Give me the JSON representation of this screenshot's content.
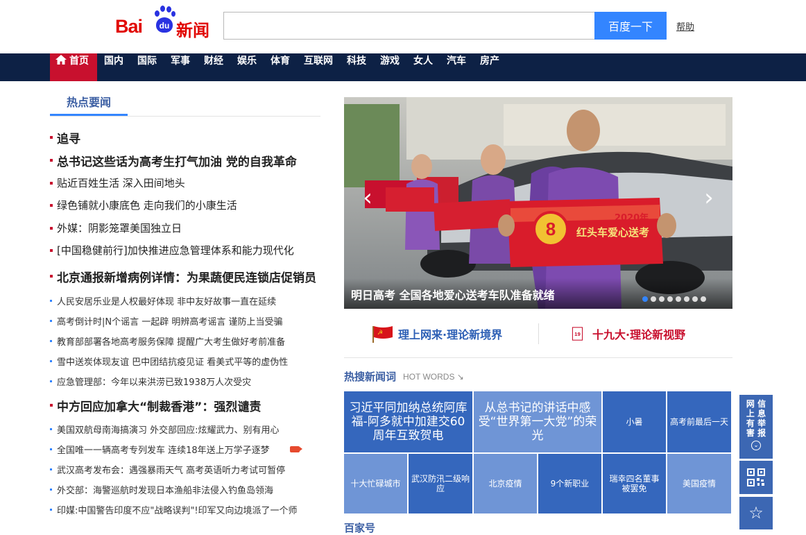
{
  "header": {
    "logo_bai": "Bai",
    "logo_du": "du",
    "logo_news": "新闻",
    "search_placeholder": "",
    "search_button": "百度一下",
    "help": "帮助"
  },
  "nav": {
    "items": [
      "首页",
      "国内",
      "国际",
      "军事",
      "财经",
      "娱乐",
      "体育",
      "互联网",
      "科技",
      "游戏",
      "女人",
      "汽车",
      "房产"
    ]
  },
  "section": {
    "title": "热点要闻"
  },
  "news": [
    {
      "text": "追寻",
      "level": 1
    },
    {
      "text": "总书记这些话为高考生打气加油 党的自我革命",
      "level": 1
    },
    {
      "text": "贴近百姓生活 深入田间地头",
      "level": 2
    },
    {
      "text": "绿色铺就小康底色 走向我们的小康生活",
      "level": 2
    },
    {
      "text": "外媒：阴影笼罩美国独立日",
      "level": 2
    },
    {
      "text": "[中国稳健前行]加快推进应急管理体系和能力现代化",
      "level": 2
    },
    {
      "text": "北京通报新增病例详情：为果蔬便民连锁店促销员",
      "level": 1
    },
    {
      "text": "人民安居乐业是人权最好体现 非中友好故事一直在延续",
      "level": 3
    },
    {
      "text": "高考倒计时|N个谣言 一起辟 明辨高考谣言 谨防上当受骗",
      "level": 3
    },
    {
      "text": "教育部部署各地高考服务保障 提醒广大考生做好考前准备",
      "level": 3
    },
    {
      "text": "雪中送炭体现友谊 巴中团结抗疫见证 看美式平等的虚伪性",
      "level": 3
    },
    {
      "text": "应急管理部：今年以来洪涝已致1938万人次受灾",
      "level": 3
    },
    {
      "text": "中方回应加拿大“制裁香港”：强烈谴责",
      "level": 1
    },
    {
      "text": "美国双航母南海搞演习 外交部回应:炫耀武力、别有用心",
      "level": 3
    },
    {
      "text": "全国唯一一辆高考专列发车 连续18年送上万学子逐梦",
      "level": 3,
      "video": true
    },
    {
      "text": "武汉高考发布会：遇强暴雨天气 高考英语听力考试可暂停",
      "level": 3
    },
    {
      "text": "外交部：海警巡航时发现日本渔船非法侵入钓鱼岛领海",
      "level": 3
    },
    {
      "text": "印媒:中国警告印度不应\"战略误判\"!印军又向边境派了一个师",
      "level": 3
    }
  ],
  "carousel": {
    "caption": "明日高考 全国各地爱心送考车队准备就绪",
    "slide_count": 8,
    "active_index": 0,
    "sign_text": "红头车爱心送考",
    "sign_year": "2020年",
    "prev_icon": "‹",
    "next_icon": "›"
  },
  "banners": {
    "left": "理上网来·理论新境界",
    "right": "十九大·理论新视野"
  },
  "hot": {
    "title": "热搜新闻词",
    "subtitle": "HOT WORDS",
    "arrow": "↘",
    "cells": [
      "习近平同加纳总统阿库福-阿多就中加建交60周年互致贺电",
      "从总书记的讲话中感受“世界第一大党”的荣光",
      "小暑",
      "高考前最后一天",
      "十大忙碌城市",
      "武汉防汛二级响应",
      "北京疫情",
      "9个新职业",
      "瑞幸四名董事被罢免",
      "美国疫情"
    ]
  },
  "bottom": {
    "title": "百家号"
  },
  "side": {
    "report": "网信上有举害报",
    "report_lines": [
      "网 信",
      "上 息",
      "有 举",
      "害 报"
    ],
    "down_icon": "⌄",
    "star_icon": "☆"
  },
  "colors": {
    "brand_red": "#c8102e",
    "nav_bg": "#0d2145",
    "accent_blue": "#3385ff",
    "tile_dark": "#3567bd",
    "tile_light": "#6f95d6"
  }
}
